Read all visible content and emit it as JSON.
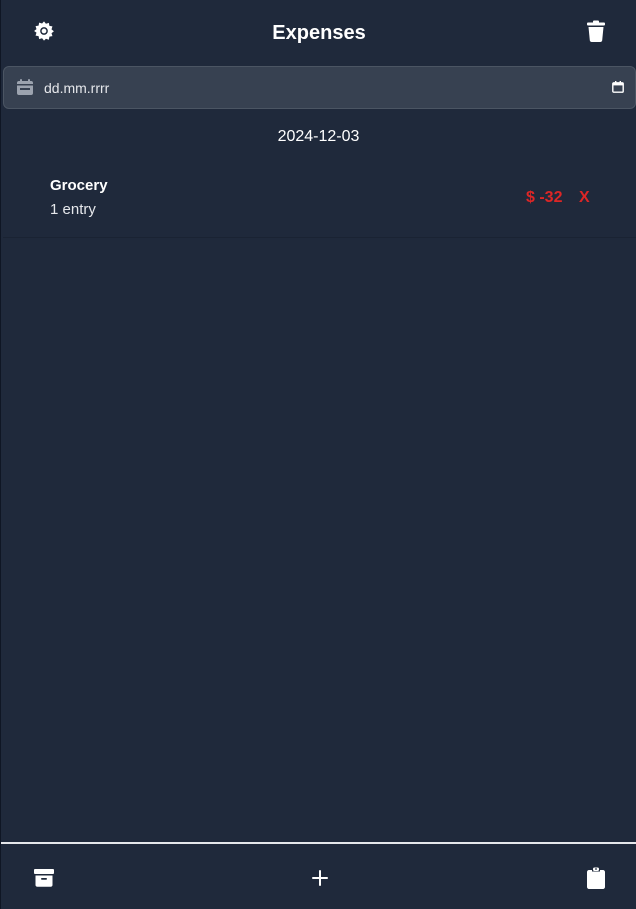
{
  "header": {
    "title": "Expenses",
    "settings_icon": "gear-icon",
    "trash_icon": "trash-icon"
  },
  "date_filter": {
    "placeholder": "dd.mm.rrrr",
    "left_icon": "calendar-icon",
    "right_icon": "calendar-picker-icon"
  },
  "days": [
    {
      "date": "2024-12-03",
      "entries": [
        {
          "category": "Grocery",
          "count_label": "1 entry",
          "amount": "$ -32",
          "remove_label": "X"
        }
      ]
    }
  ],
  "footer": {
    "archive_icon": "archive-icon",
    "add_icon": "plus-icon",
    "clipboard_icon": "clipboard-icon"
  },
  "colors": {
    "background": "#1f293b",
    "input_bg": "#374151",
    "negative": "#dc2626",
    "text": "#ffffff"
  }
}
